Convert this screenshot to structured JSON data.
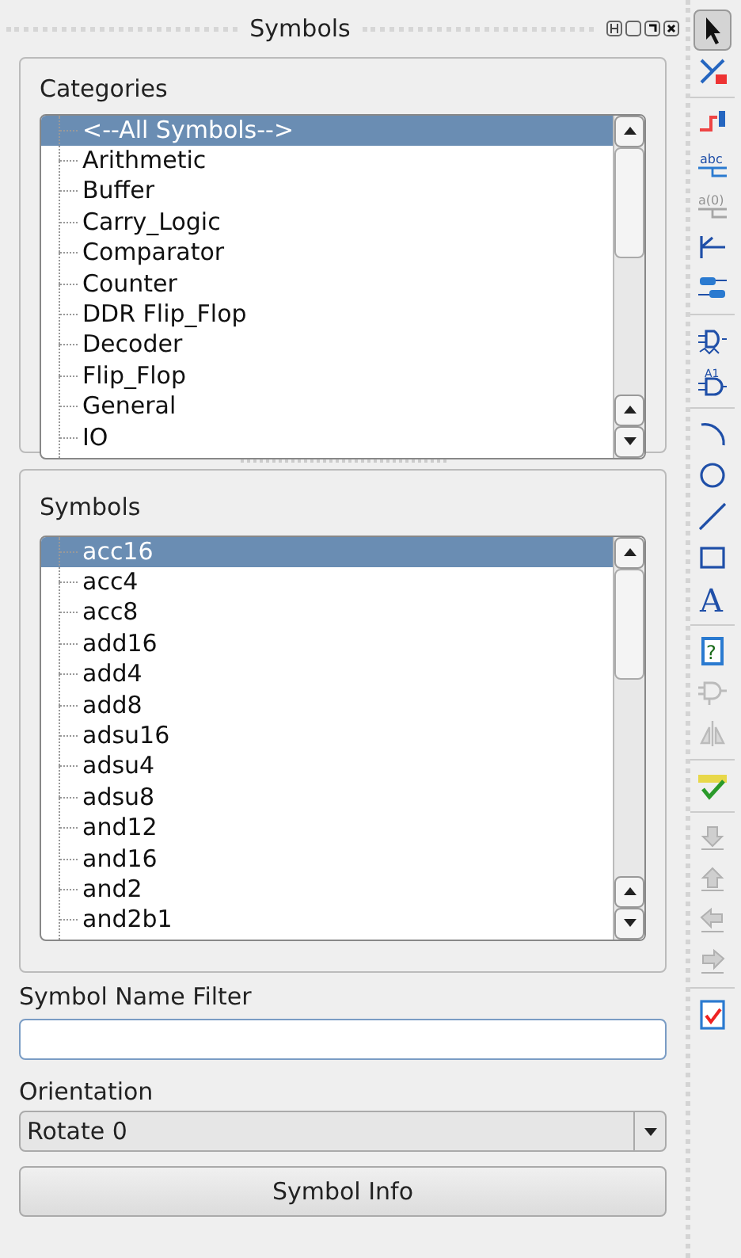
{
  "panel": {
    "title": "Symbols"
  },
  "categories": {
    "label": "Categories",
    "items": [
      {
        "name": "<--All Symbols-->",
        "selected": true
      },
      {
        "name": "Arithmetic",
        "selected": false
      },
      {
        "name": "Buffer",
        "selected": false
      },
      {
        "name": "Carry_Logic",
        "selected": false
      },
      {
        "name": "Comparator",
        "selected": false
      },
      {
        "name": "Counter",
        "selected": false
      },
      {
        "name": "DDR Flip_Flop",
        "selected": false
      },
      {
        "name": "Decoder",
        "selected": false
      },
      {
        "name": "Flip_Flop",
        "selected": false
      },
      {
        "name": "General",
        "selected": false
      },
      {
        "name": "IO",
        "selected": false
      }
    ]
  },
  "symbols": {
    "label": "Symbols",
    "items": [
      {
        "name": "acc16",
        "selected": true
      },
      {
        "name": "acc4",
        "selected": false
      },
      {
        "name": "acc8",
        "selected": false
      },
      {
        "name": "add16",
        "selected": false
      },
      {
        "name": "add4",
        "selected": false
      },
      {
        "name": "add8",
        "selected": false
      },
      {
        "name": "adsu16",
        "selected": false
      },
      {
        "name": "adsu4",
        "selected": false
      },
      {
        "name": "adsu8",
        "selected": false
      },
      {
        "name": "and12",
        "selected": false
      },
      {
        "name": "and16",
        "selected": false
      },
      {
        "name": "and2",
        "selected": false
      },
      {
        "name": "and2b1",
        "selected": false
      }
    ]
  },
  "filter": {
    "label": "Symbol Name Filter"
  },
  "orientation": {
    "label": "Orientation",
    "value": "Rotate 0"
  },
  "info_button": {
    "label": "Symbol Info"
  },
  "toolbar": [
    [
      {
        "selected": true,
        "disabled": false
      },
      {
        "selected": false,
        "disabled": false
      }
    ],
    [
      {
        "selected": false,
        "disabled": false
      },
      {
        "selected": false,
        "disabled": false,
        "text": "abc"
      },
      {
        "selected": false,
        "disabled": true,
        "text": "a(0)"
      },
      {
        "selected": false,
        "disabled": false
      },
      {
        "selected": false,
        "disabled": false
      }
    ],
    [
      {
        "selected": false,
        "disabled": false
      },
      {
        "selected": false,
        "disabled": false,
        "text": "A1"
      }
    ],
    [
      {
        "selected": false,
        "disabled": false
      },
      {
        "selected": false,
        "disabled": false
      },
      {
        "selected": false,
        "disabled": false
      },
      {
        "selected": false,
        "disabled": false
      },
      {
        "selected": false,
        "disabled": false,
        "text": "A"
      }
    ],
    [
      {
        "selected": false,
        "disabled": false,
        "text": "?"
      },
      {
        "selected": false,
        "disabled": true
      },
      {
        "selected": false,
        "disabled": true
      }
    ],
    [
      {
        "selected": false,
        "disabled": false
      }
    ],
    [
      {
        "selected": false,
        "disabled": true
      },
      {
        "selected": false,
        "disabled": true
      },
      {
        "selected": false,
        "disabled": true
      },
      {
        "selected": false,
        "disabled": true
      }
    ],
    [
      {
        "selected": false,
        "disabled": false
      }
    ]
  ]
}
